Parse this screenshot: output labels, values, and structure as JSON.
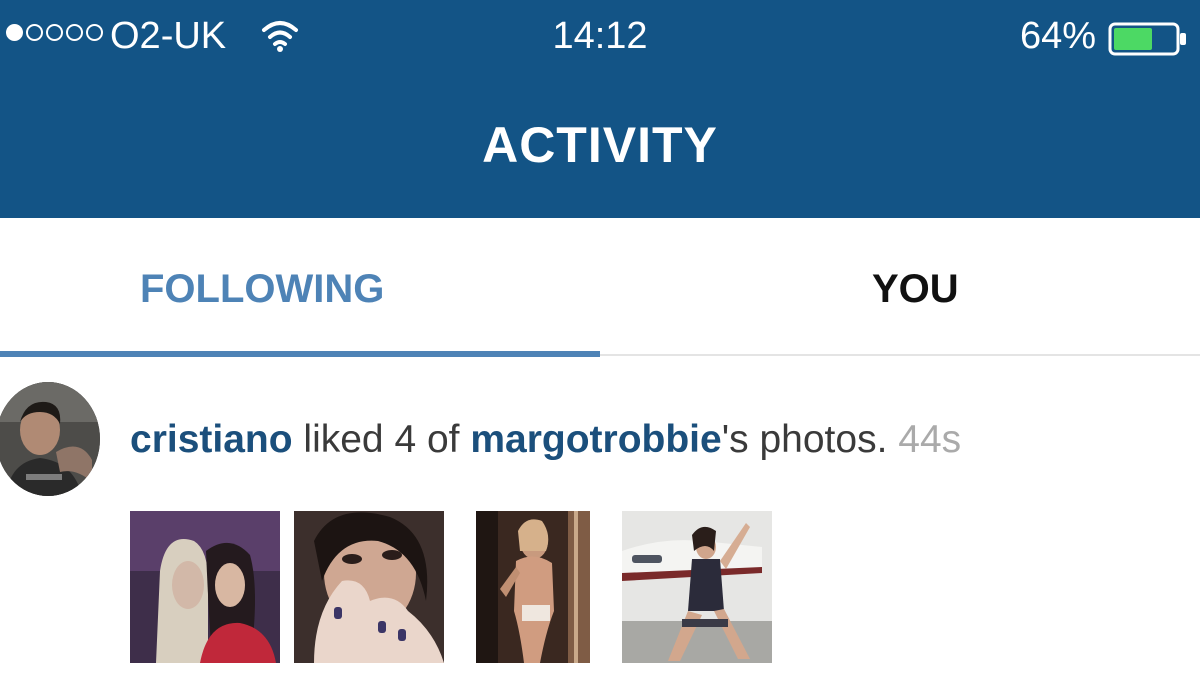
{
  "status_bar": {
    "carrier": "O2-UK",
    "time": "14:12",
    "battery_percent": "64%",
    "battery_level": 0.64,
    "signal_bars_filled": 1,
    "signal_bars_total": 5
  },
  "nav": {
    "title": "ACTIVITY"
  },
  "tabs": {
    "following": "FOLLOWING",
    "you": "YOU",
    "active": "following"
  },
  "activity": {
    "user": "cristiano",
    "action": " liked 4 of ",
    "target_user": "margotrobbie",
    "suffix": "'s photos.",
    "time": "44s",
    "photo_count": 4
  },
  "colors": {
    "header_bg": "#135486",
    "tab_active": "#4e83b6",
    "username": "#1b4f7c",
    "timestamp": "#aaaaaa",
    "battery_fill": "#4cd964"
  },
  "icons": {
    "wifi": "wifi-icon",
    "battery": "battery-icon",
    "signal": "signal-dots-icon"
  }
}
